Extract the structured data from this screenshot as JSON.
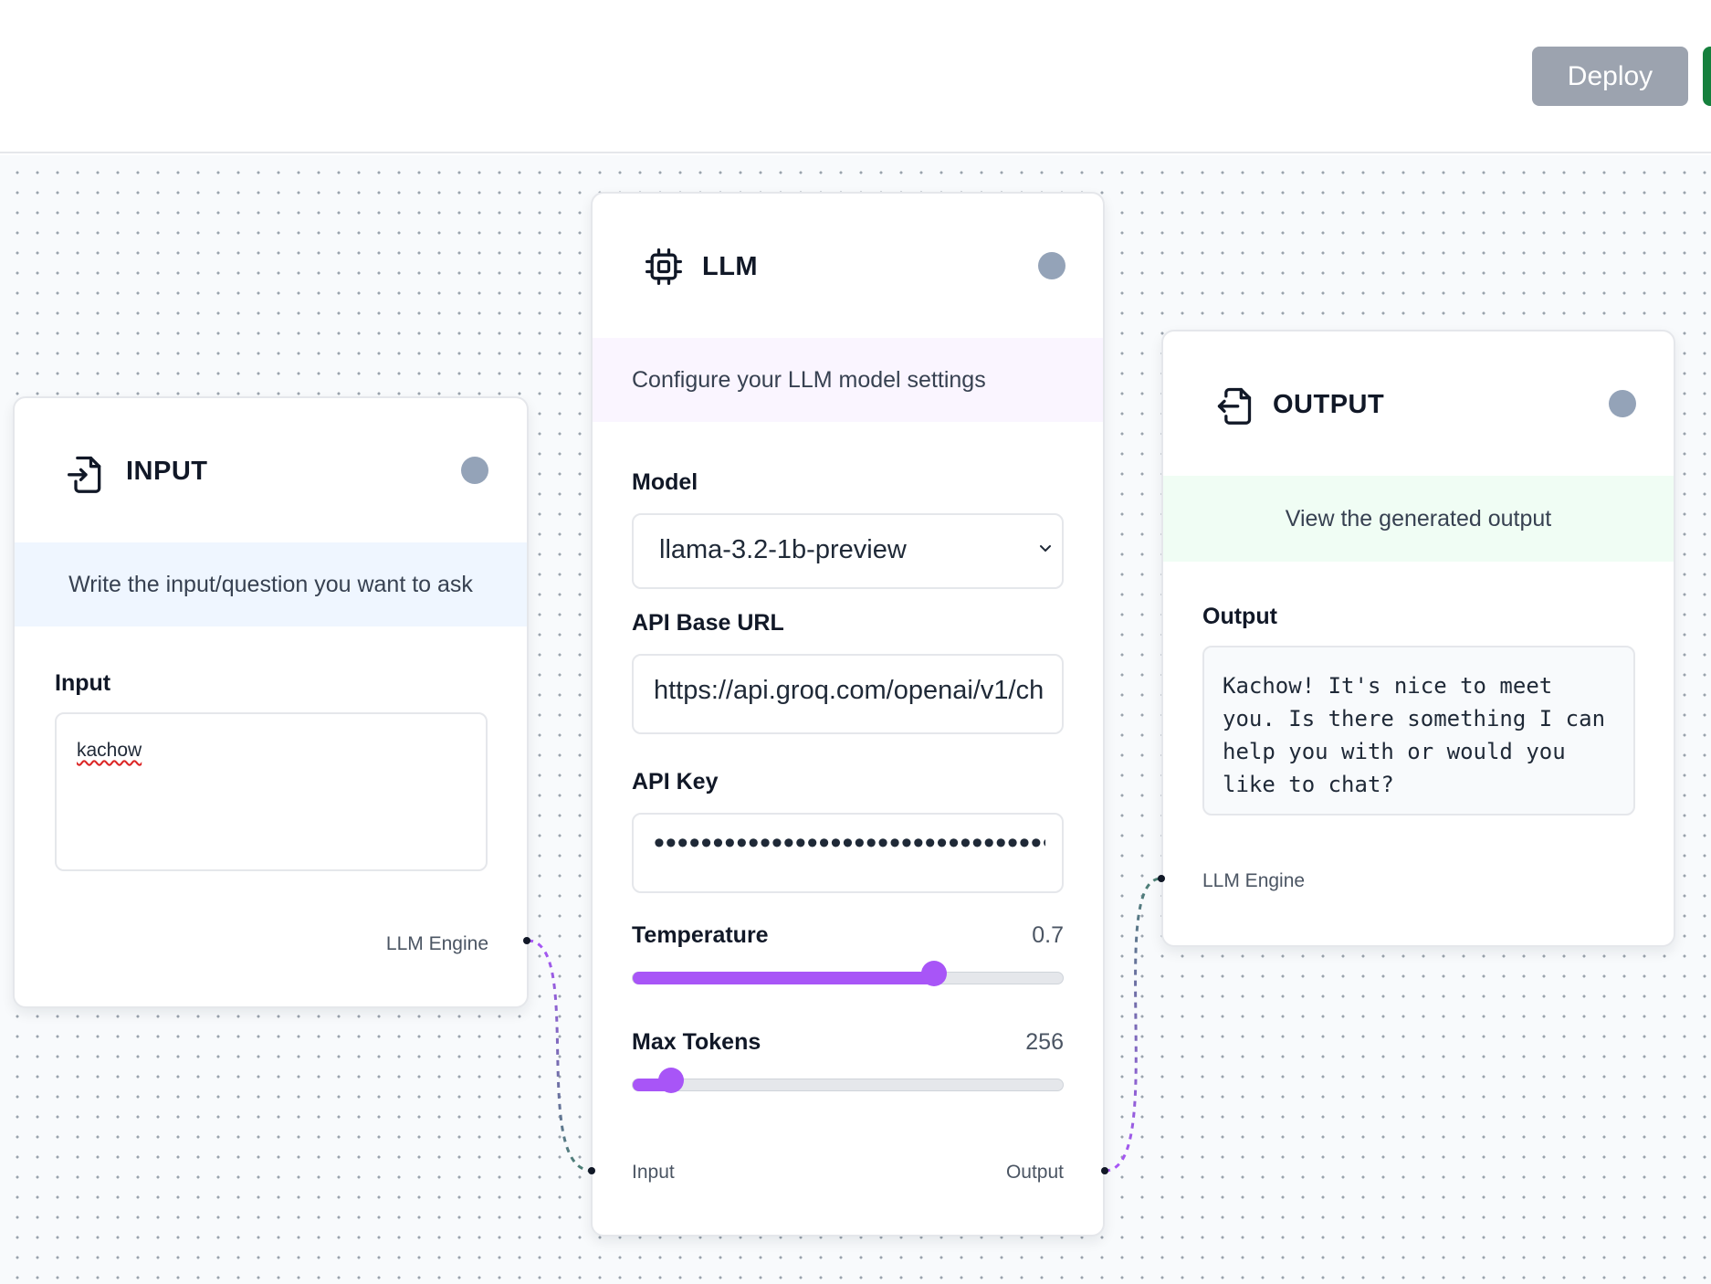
{
  "toolbar": {
    "deploy_label": "Deploy"
  },
  "input_node": {
    "title": "INPUT",
    "description": "Write the input/question you want to ask",
    "field_label": "Input",
    "value": "kachow",
    "footer_label": "LLM Engine",
    "icon": "file-import-icon"
  },
  "llm_node": {
    "title": "LLM",
    "description": "Configure your LLM model settings",
    "model_label": "Model",
    "model_value": "llama-3.2-1b-preview",
    "api_base_label": "API Base URL",
    "api_base_value": "https://api.groq.com/openai/v1/ch",
    "api_key_label": "API Key",
    "api_key_value": "•••••••••••••••••••••••••••••••••••",
    "temperature_label": "Temperature",
    "temperature_value": "0.7",
    "temperature_fraction": 0.7,
    "max_tokens_label": "Max Tokens",
    "max_tokens_value": "256",
    "max_tokens_fraction": 0.09,
    "input_handle_label": "Input",
    "output_handle_label": "Output",
    "icon": "cpu-chip-icon"
  },
  "output_node": {
    "title": "OUTPUT",
    "description": "View the generated output",
    "field_label": "Output",
    "value": "Kachow! It's nice to meet you. Is there something I can help you with or would you like to chat?",
    "footer_label": "LLM Engine",
    "icon": "file-export-icon"
  },
  "colors": {
    "accent": "#a855f7",
    "status_dot": "#94a3b8",
    "input_desc_bg": "#eff6ff",
    "llm_desc_bg": "#faf5ff",
    "output_desc_bg": "#f0fdf4",
    "deploy_bg": "#9ca3af",
    "run_bg": "#15803d"
  }
}
